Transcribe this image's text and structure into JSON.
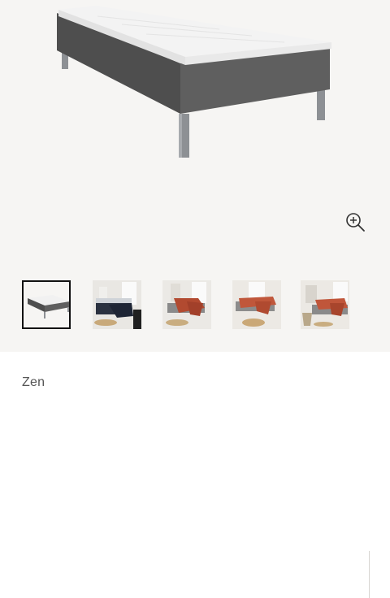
{
  "product": {
    "name": "Zen"
  },
  "gallery": {
    "main_image": "single-box-bed-grey-with-mattress-topper",
    "zoom_icon": "zoom-in-icon",
    "active_index": 0,
    "thumbnails": [
      {
        "label": "bed-product-photo"
      },
      {
        "label": "bedroom-scene-navy-throw"
      },
      {
        "label": "bedroom-scene-rust-bedding"
      },
      {
        "label": "bedroom-scene-rust-bedding-rug"
      },
      {
        "label": "bedroom-scene-rust-bedding-chair"
      }
    ]
  },
  "colors": {
    "fabric": "#5a5a5a",
    "topper": "#f3f3f3",
    "legs": "#8d9094",
    "background": "#f6f5f3"
  }
}
